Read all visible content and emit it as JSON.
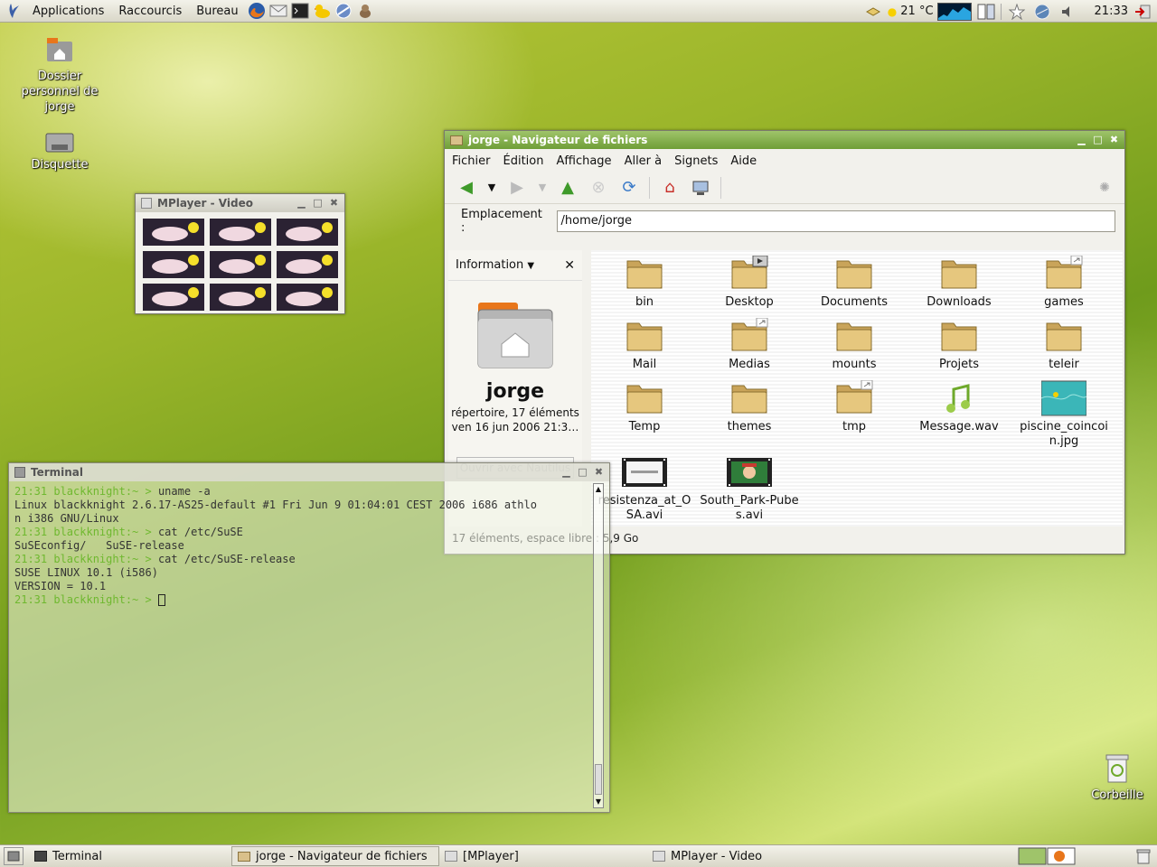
{
  "top_panel": {
    "menus": [
      "Applications",
      "Raccourcis",
      "Bureau"
    ],
    "weather": "21 °C",
    "clock": "21:33"
  },
  "desktop": {
    "home_icon_label": "Dossier personnel de jorge",
    "floppy_label": "Disquette",
    "trash_label": "Corbeille"
  },
  "nautilus": {
    "title": "jorge - Navigateur de fichiers",
    "menus": [
      "Fichier",
      "Édition",
      "Affichage",
      "Aller à",
      "Signets",
      "Aide"
    ],
    "location_label": "Emplacement :",
    "location_value": "/home/jorge",
    "sidepane": {
      "selector": "Information",
      "name": "jorge",
      "details": "répertoire, 17 éléments",
      "date": "ven 16 jun 2006 21:3…",
      "open_with": "Ouvrir avec Nautilus"
    },
    "files": [
      {
        "name": "bin",
        "kind": "folder"
      },
      {
        "name": "Desktop",
        "kind": "folder-emblem"
      },
      {
        "name": "Documents",
        "kind": "folder"
      },
      {
        "name": "Downloads",
        "kind": "folder"
      },
      {
        "name": "games",
        "kind": "folder-link"
      },
      {
        "name": "Mail",
        "kind": "folder"
      },
      {
        "name": "Medias",
        "kind": "folder-link"
      },
      {
        "name": "mounts",
        "kind": "folder"
      },
      {
        "name": "Projets",
        "kind": "folder"
      },
      {
        "name": "teleir",
        "kind": "folder"
      },
      {
        "name": "Temp",
        "kind": "folder"
      },
      {
        "name": "themes",
        "kind": "folder"
      },
      {
        "name": "tmp",
        "kind": "folder-link"
      },
      {
        "name": "Message.wav",
        "kind": "audio"
      },
      {
        "name": "piscine_coincoin.jpg",
        "kind": "image"
      },
      {
        "name": "resistenza_at_OSA.avi",
        "kind": "video"
      },
      {
        "name": "South_Park-Pubes.avi",
        "kind": "video"
      }
    ],
    "status": "17 éléments, espace libre : 5,9 Go"
  },
  "mplayer": {
    "title": "MPlayer - Video"
  },
  "terminal": {
    "title": "Terminal",
    "lines": [
      {
        "prompt": "21:31 blackknight:~ > ",
        "text": "uname -a"
      },
      {
        "prompt": "",
        "text": "Linux blackknight 2.6.17-AS25-default #1 Fri Jun 9 01:04:01 CEST 2006 i686 athlo"
      },
      {
        "prompt": "",
        "text": "n i386 GNU/Linux"
      },
      {
        "prompt": "21:31 blackknight:~ > ",
        "text": "cat /etc/SuSE"
      },
      {
        "prompt": "",
        "text": "SuSEconfig/   SuSE-release"
      },
      {
        "prompt": "21:31 blackknight:~ > ",
        "text": "cat /etc/SuSE-release"
      },
      {
        "prompt": "",
        "text": "SUSE LINUX 10.1 (i586)"
      },
      {
        "prompt": "",
        "text": "VERSION = 10.1"
      },
      {
        "prompt": "21:31 blackknight:~ > ",
        "text": ""
      }
    ]
  },
  "taskbar": {
    "tasks": [
      "Terminal",
      "jorge - Navigateur de fichiers",
      "[MPlayer]",
      "MPlayer - Video"
    ]
  }
}
